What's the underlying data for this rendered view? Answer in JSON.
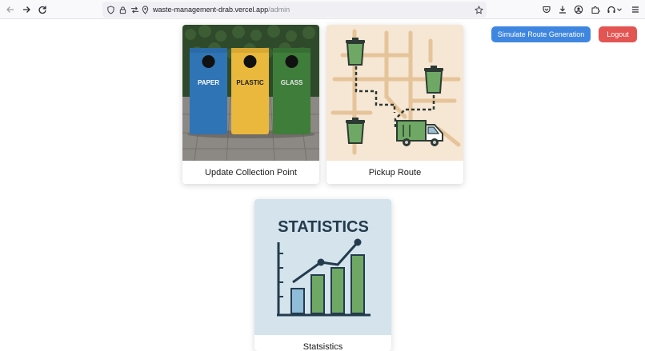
{
  "browser": {
    "url_host": "waste-management-drab.vercel.app",
    "url_path": "/admin",
    "icons": [
      "back-icon",
      "forward-icon",
      "reload-icon",
      "shield-icon",
      "lock-icon",
      "permissions-icon",
      "location-icon",
      "bookmark-star-icon",
      "pocket-icon",
      "download-icon",
      "account-icon",
      "extensions-icon",
      "headphones-icon",
      "chevron-down-icon",
      "menu-icon"
    ]
  },
  "header": {
    "simulate_label": "Simulate Route Generation",
    "logout_label": "Logout"
  },
  "cards": [
    {
      "label": "Update Collection Point",
      "bins": [
        "PAPER",
        "PLASTIC",
        "GLASS"
      ]
    },
    {
      "label": "Pickup Route"
    },
    {
      "label": "Statsistics",
      "image_title": "STATISTICS"
    }
  ],
  "colors": {
    "primary": "#3f86e0",
    "danger": "#e25552",
    "bin_paper": "#2f74b5",
    "bin_plastic": "#e9b83d",
    "bin_glass": "#3f7d3a",
    "stats_bg": "#d4e3ec",
    "route_bg": "#f6e6d4"
  }
}
